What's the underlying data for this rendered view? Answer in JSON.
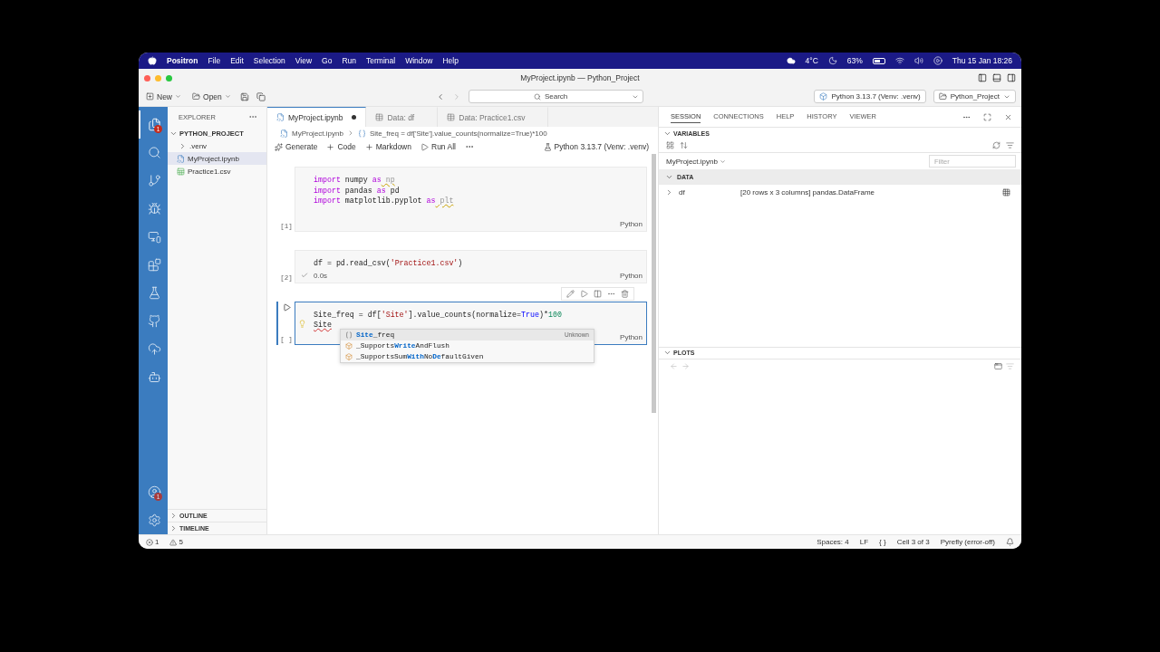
{
  "menubar": {
    "app": "Positron",
    "menus": [
      "File",
      "Edit",
      "Selection",
      "View",
      "Go",
      "Run",
      "Terminal",
      "Window",
      "Help"
    ],
    "temperature": "4°C",
    "battery": "63%",
    "datetime": "Thu 15 Jan  18:26"
  },
  "window": {
    "title": "MyProject.ipynb — Python_Project"
  },
  "toolbar": {
    "new": "New",
    "open": "Open",
    "search": "Search",
    "interpreter": "Python 3.13.7 (Venv: .venv)",
    "project": "Python_Project"
  },
  "activity_bar": [
    {
      "kind": "explorer",
      "selected": true,
      "badge": "1"
    },
    {
      "kind": "search",
      "selected": false
    },
    {
      "kind": "source-control",
      "selected": false
    },
    {
      "kind": "run",
      "selected": false
    },
    {
      "kind": "remote",
      "selected": false
    },
    {
      "kind": "extensions",
      "selected": false
    },
    {
      "kind": "testing",
      "selected": false
    },
    {
      "kind": "github",
      "selected": false
    },
    {
      "kind": "publish",
      "selected": false
    },
    {
      "kind": "copilot",
      "selected": false
    }
  ],
  "activity_bottom": [
    {
      "kind": "account",
      "badge": "1"
    },
    {
      "kind": "settings"
    }
  ],
  "explorer": {
    "title": "EXPLORER",
    "project": "PYTHON_PROJECT",
    "items": [
      {
        "label": ".venv",
        "kind": "folder",
        "selected": false
      },
      {
        "label": "MyProject.ipynb",
        "kind": "notebook",
        "selected": true
      },
      {
        "label": "Practice1.csv",
        "kind": "csv",
        "selected": false
      }
    ],
    "sections": [
      "OUTLINE",
      "TIMELINE"
    ]
  },
  "tabs": [
    {
      "label": "MyProject.ipynb",
      "kind": "notebook",
      "selected": true,
      "modified": true
    },
    {
      "label": "Data: df",
      "kind": "data",
      "selected": false,
      "modified": false
    },
    {
      "label": "Data: Practice1.csv",
      "kind": "data",
      "selected": false,
      "modified": false
    }
  ],
  "breadcrumb": {
    "file": "MyProject.ipynb",
    "symbol": "Site_freq = df['Site'].value_counts(normalize=True)*100"
  },
  "notebook_toolbar": {
    "actions": [
      {
        "label": "Generate",
        "kind": "generate"
      },
      {
        "label": "Code",
        "kind": "add"
      },
      {
        "label": "Markdown",
        "kind": "add"
      },
      {
        "label": "Run All",
        "kind": "run"
      }
    ],
    "kernel": "Python 3.13.7 (Venv: .venv)"
  },
  "cells": [
    {
      "execution": "[1]",
      "language": "Python",
      "active": false,
      "lines": [
        [
          {
            "text": "import",
            "kind": "keyword"
          },
          {
            "text": " numpy ",
            "kind": "plain"
          },
          {
            "text": "as",
            "kind": "keyword"
          },
          {
            "text": " np",
            "kind": "unused"
          }
        ],
        [
          {
            "text": "import",
            "kind": "keyword"
          },
          {
            "text": " pandas ",
            "kind": "plain"
          },
          {
            "text": "as",
            "kind": "keyword"
          },
          {
            "text": " pd",
            "kind": "plain"
          }
        ],
        [
          {
            "text": "import",
            "kind": "keyword"
          },
          {
            "text": " matplotlib.pyplot ",
            "kind": "plain"
          },
          {
            "text": "as",
            "kind": "keyword"
          },
          {
            "text": " plt",
            "kind": "unused"
          }
        ]
      ]
    },
    {
      "execution": "[2]",
      "language": "Python",
      "active": false,
      "timing": "0.0s",
      "lines": [
        [
          {
            "text": "df = pd.read_csv(",
            "kind": "plain"
          },
          {
            "text": "'Practice1.csv'",
            "kind": "string"
          },
          {
            "text": ")",
            "kind": "plain"
          }
        ]
      ]
    },
    {
      "execution": "[ ]",
      "language": "Python",
      "active": true,
      "lines": [
        [
          {
            "text": "Site_freq = df[",
            "kind": "plain"
          },
          {
            "text": "'Site'",
            "kind": "string"
          },
          {
            "text": "].value_counts(normalize=",
            "kind": "plain"
          },
          {
            "text": "True",
            "kind": "constant"
          },
          {
            "text": ")*",
            "kind": "plain"
          },
          {
            "text": "100",
            "kind": "number"
          }
        ],
        [
          {
            "text": "Site",
            "kind": "error"
          }
        ]
      ]
    }
  ],
  "suggestions": [
    {
      "label": "**Site**_freq",
      "detail": "Unknown",
      "kind": "variable",
      "selected": true
    },
    {
      "label": "_Supports**Write**AndFlush",
      "kind": "class",
      "selected": false
    },
    {
      "label": "_SupportsSum**With**No**De**faultGiven",
      "kind": "class",
      "selected": false
    }
  ],
  "panel": {
    "tabs": [
      {
        "label": "SESSION",
        "selected": true
      },
      {
        "label": "CONNECTIONS",
        "selected": false
      },
      {
        "label": "HELP",
        "selected": false
      },
      {
        "label": "HISTORY",
        "selected": false
      },
      {
        "label": "VIEWER",
        "selected": false
      }
    ],
    "variables": {
      "title": "VARIABLES",
      "source": "MyProject.ipynb",
      "filter_placeholder": "Filter",
      "group": "DATA",
      "rows": [
        {
          "name": "df",
          "value": "[20 rows x 3 columns] pandas.DataFrame"
        }
      ]
    },
    "plots": {
      "title": "PLOTS"
    }
  },
  "status_bar": {
    "errors": "1",
    "warnings": "5",
    "items": [
      "Spaces: 4",
      "LF",
      "{ }",
      "Cell 3 of 3",
      "Pyrefly (error-off)"
    ]
  }
}
